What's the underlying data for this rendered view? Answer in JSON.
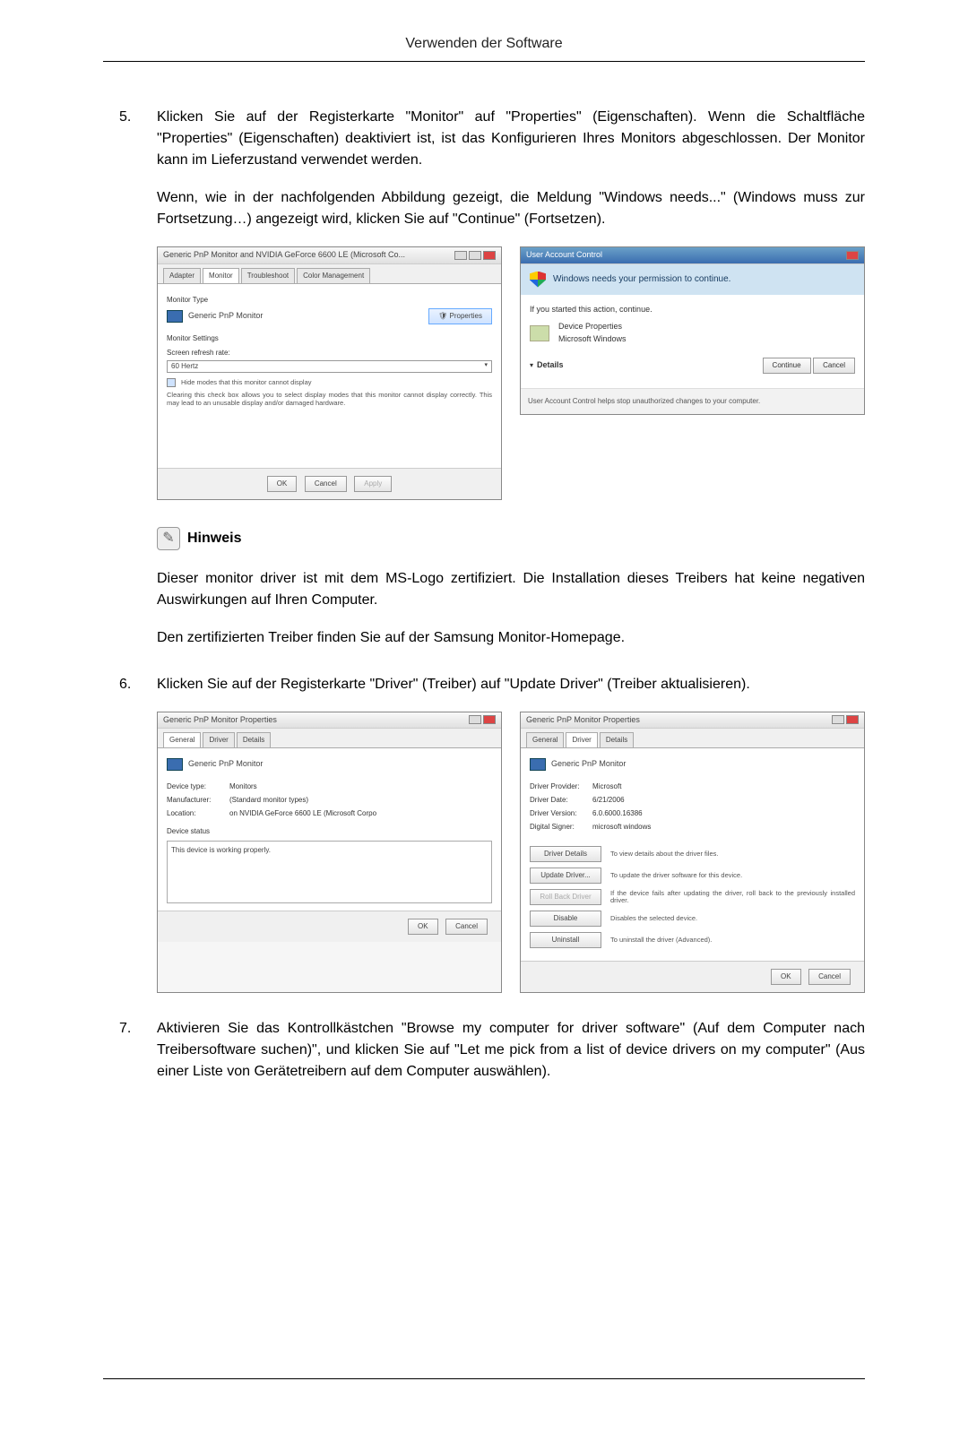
{
  "page_header": "Verwenden der Software",
  "steps": {
    "s5": {
      "num": "5.",
      "p1": "Klicken Sie auf der Registerkarte \"Monitor\" auf \"Properties\" (Eigenschaften). Wenn die Schaltfläche \"Properties\" (Eigenschaften) deaktiviert ist, ist das Konfigurieren Ihres Monitors abgeschlossen. Der Monitor kann im Lieferzustand verwendet werden.",
      "p2": "Wenn, wie in der nachfolgenden Abbildung gezeigt, die Meldung \"Windows needs...\" (Windows muss zur Fortsetzung…) angezeigt wird, klicken Sie auf \"Continue\" (Fortsetzen)."
    },
    "s6": {
      "num": "6.",
      "p1": "Klicken Sie auf der Registerkarte \"Driver\" (Treiber) auf \"Update Driver\" (Treiber aktualisieren)."
    },
    "s7": {
      "num": "7.",
      "p1": "Aktivieren Sie das Kontrollkästchen \"Browse my computer for driver software\" (Auf dem Computer nach Treibersoftware suchen)\", und klicken Sie auf \"Let me pick from a list of device drivers on my computer\" (Aus einer Liste von Gerätetreibern auf dem Computer auswählen)."
    }
  },
  "note": {
    "label": "Hinweis",
    "p1": "Dieser monitor driver ist mit dem MS-Logo zertifiziert. Die Installation dieses Treibers hat keine negativen Auswirkungen auf Ihren Computer.",
    "p2": "Den zertifizierten Treiber finden Sie auf der Samsung Monitor-Homepage."
  },
  "monitor_dialog": {
    "title": "Generic PnP Monitor and NVIDIA GeForce 6600 LE (Microsoft Co...",
    "tabs": [
      "Adapter",
      "Monitor",
      "Troubleshoot",
      "Color Management"
    ],
    "monitor_type_label": "Monitor Type",
    "monitor_type_value": "Generic PnP Monitor",
    "properties_btn": "Properties",
    "settings_label": "Monitor Settings",
    "refresh_label": "Screen refresh rate:",
    "refresh_value": "60 Hertz",
    "hide_modes": "Hide modes that this monitor cannot display",
    "hide_modes_desc": "Clearing this check box allows you to select display modes that this monitor cannot display correctly. This may lead to an unusable display and/or damaged hardware.",
    "ok": "OK",
    "cancel": "Cancel",
    "apply": "Apply"
  },
  "uac_dialog": {
    "title": "User Account Control",
    "headline": "Windows needs your permission to continue.",
    "started": "If you started this action, continue.",
    "prog_name": "Device Properties",
    "prog_vendor": "Microsoft Windows",
    "details": "Details",
    "continue": "Continue",
    "cancel": "Cancel",
    "footer": "User Account Control helps stop unauthorized changes to your computer."
  },
  "prop_general": {
    "title": "Generic PnP Monitor Properties",
    "tabs": [
      "General",
      "Driver",
      "Details"
    ],
    "device": "Generic PnP Monitor",
    "kv": {
      "dtype_k": "Device type:",
      "dtype_v": "Monitors",
      "manu_k": "Manufacturer:",
      "manu_v": "(Standard monitor types)",
      "loc_k": "Location:",
      "loc_v": "on NVIDIA GeForce 6600 LE (Microsoft Corpo"
    },
    "status_label": "Device status",
    "status_text": "This device is working properly.",
    "ok": "OK",
    "cancel": "Cancel"
  },
  "prop_driver": {
    "title": "Generic PnP Monitor Properties",
    "tabs": [
      "General",
      "Driver",
      "Details"
    ],
    "device": "Generic PnP Monitor",
    "kv": {
      "prov_k": "Driver Provider:",
      "prov_v": "Microsoft",
      "date_k": "Driver Date:",
      "date_v": "6/21/2006",
      "ver_k": "Driver Version:",
      "ver_v": "6.0.6000.16386",
      "sign_k": "Digital Signer:",
      "sign_v": "microsoft windows"
    },
    "buttons": {
      "details": "Driver Details",
      "details_d": "To view details about the driver files.",
      "update": "Update Driver...",
      "update_d": "To update the driver software for this device.",
      "roll": "Roll Back Driver",
      "roll_d": "If the device fails after updating the driver, roll back to the previously installed driver.",
      "disable": "Disable",
      "disable_d": "Disables the selected device.",
      "uninstall": "Uninstall",
      "uninstall_d": "To uninstall the driver (Advanced)."
    },
    "ok": "OK",
    "cancel": "Cancel"
  }
}
